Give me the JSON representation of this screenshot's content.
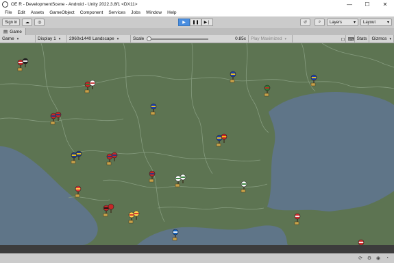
{
  "window": {
    "title": "OE R - DevelopmentScene - Android - Unity 2022.3.8f1 <DX11>",
    "controls": [
      "—",
      "☐",
      "✕"
    ]
  },
  "menu": [
    "File",
    "Edit",
    "Assets",
    "GameObject",
    "Component",
    "Services",
    "Jobs",
    "Window",
    "Help"
  ],
  "toolbar": {
    "sign_in": "Sign in",
    "layers": "Layers",
    "layout": "Layout"
  },
  "tab": {
    "label": "Game"
  },
  "game_toolbar": {
    "mode": "Game",
    "display": "Display 1",
    "resolution": "2960x1440 Landscape",
    "scale_label": "Scale",
    "scale_value": "0.85x",
    "play_maximized": "Play Maximized",
    "stats": "Stats",
    "gizmos": "Gizmos"
  },
  "colors": {
    "land": "#5d7452",
    "sea": "#5f7588",
    "border": "#869c7f",
    "pin": "#3a2a1a",
    "accent_play": "#4a8ee0"
  },
  "map_pins": [
    {
      "flags": [
        "red-white",
        "black-white"
      ]
    },
    {
      "flags": [
        "red-green-white",
        "white-red"
      ]
    },
    {
      "flags": [
        "blue-yellow-red"
      ]
    },
    {
      "flags": [
        "blue-yellow"
      ]
    },
    {
      "flags": [
        "green-white-red-circle"
      ]
    },
    {
      "flags": [
        "serbia",
        "croatia"
      ]
    },
    {
      "flags": [
        "blue-yellow-red"
      ]
    },
    {
      "flags": [
        "blue-yellow",
        "red-yellow-blue"
      ]
    },
    {
      "flags": [
        "bosnia",
        "bosnia"
      ]
    },
    {
      "flags": [
        "serbia",
        "serbia"
      ]
    },
    {
      "flags": [
        "serbia"
      ]
    },
    {
      "flags": [
        "bulgaria",
        "bulgaria"
      ]
    },
    {
      "flags": [
        "bulgaria"
      ]
    },
    {
      "flags": [
        "albania-sun"
      ]
    },
    {
      "flags": [
        "red-black",
        "red"
      ]
    },
    {
      "flags": [
        "north-macedonia",
        "north-macedonia"
      ]
    },
    {
      "flags": [
        "greece"
      ]
    },
    {
      "flags": [
        "turkey"
      ]
    },
    {
      "flags": [
        "turkey"
      ]
    }
  ]
}
